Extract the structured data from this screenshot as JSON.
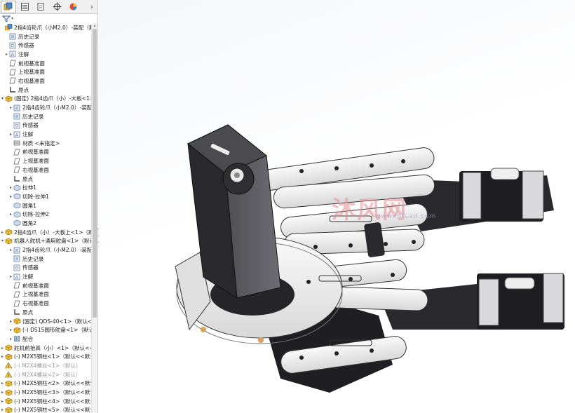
{
  "tabs": [
    "feature-manager",
    "property-manager",
    "configuration-manager",
    "dimxpert-manager",
    "display-manager"
  ],
  "tree": [
    {
      "label": "2指4齿轮爪（小M2.0）-装配（默认<",
      "indent": 0,
      "exp": "",
      "icon": "assembly"
    },
    {
      "label": "历史记录",
      "indent": 1,
      "exp": "",
      "icon": "history"
    },
    {
      "label": "传感器",
      "indent": 1,
      "exp": "",
      "icon": "sensor"
    },
    {
      "label": "注解",
      "indent": 1,
      "exp": "▸",
      "icon": "annotation"
    },
    {
      "label": "前视基准面",
      "indent": 1,
      "exp": "",
      "icon": "plane"
    },
    {
      "label": "上视基准面",
      "indent": 1,
      "exp": "",
      "icon": "plane"
    },
    {
      "label": "右视基准面",
      "indent": 1,
      "exp": "",
      "icon": "plane"
    },
    {
      "label": "原点",
      "indent": 1,
      "exp": "",
      "icon": "origin"
    },
    {
      "label": "(固定) 2指4齿爪（小）-大板<1>",
      "indent": 0,
      "exp": "▾",
      "icon": "part"
    },
    {
      "label": "2指4齿轮爪（小M2.0）-装配",
      "indent": 2,
      "exp": "▸",
      "icon": "history"
    },
    {
      "label": "历史记录",
      "indent": 2,
      "exp": "",
      "icon": "history"
    },
    {
      "label": "传感器",
      "indent": 2,
      "exp": "",
      "icon": "sensor"
    },
    {
      "label": "注解",
      "indent": 2,
      "exp": "▸",
      "icon": "annotation"
    },
    {
      "label": "材质 <未指定>",
      "indent": 2,
      "exp": "",
      "icon": "material"
    },
    {
      "label": "前视基准面",
      "indent": 2,
      "exp": "",
      "icon": "plane"
    },
    {
      "label": "上视基准面",
      "indent": 2,
      "exp": "",
      "icon": "plane"
    },
    {
      "label": "右视基准面",
      "indent": 2,
      "exp": "",
      "icon": "plane"
    },
    {
      "label": "原点",
      "indent": 2,
      "exp": "",
      "icon": "origin"
    },
    {
      "label": "拉伸1",
      "indent": 2,
      "exp": "▸",
      "icon": "feature"
    },
    {
      "label": "切除-拉伸1",
      "indent": 2,
      "exp": "▸",
      "icon": "feature"
    },
    {
      "label": "圆角1",
      "indent": 2,
      "exp": "",
      "icon": "feature"
    },
    {
      "label": "切除-拉伸2",
      "indent": 2,
      "exp": "▸",
      "icon": "feature"
    },
    {
      "label": "圆角2",
      "indent": 2,
      "exp": "",
      "icon": "feature"
    },
    {
      "label": "2指4齿爪（小）-大板上<1>（默",
      "indent": 0,
      "exp": "▸",
      "icon": "part"
    },
    {
      "label": "机器人舵机+通用舵盘<1>（默认",
      "indent": 0,
      "exp": "▾",
      "icon": "part"
    },
    {
      "label": "2指4齿轮爪（小M2.0）-装配",
      "indent": 2,
      "exp": "▸",
      "icon": "history"
    },
    {
      "label": "历史记录",
      "indent": 2,
      "exp": "",
      "icon": "history"
    },
    {
      "label": "传感器",
      "indent": 2,
      "exp": "",
      "icon": "sensor"
    },
    {
      "label": "注解",
      "indent": 2,
      "exp": "▸",
      "icon": "annotation"
    },
    {
      "label": "前视基准面",
      "indent": 2,
      "exp": "",
      "icon": "plane"
    },
    {
      "label": "上视基准面",
      "indent": 2,
      "exp": "",
      "icon": "plane"
    },
    {
      "label": "右视基准面",
      "indent": 2,
      "exp": "",
      "icon": "plane"
    },
    {
      "label": "原点",
      "indent": 2,
      "exp": "",
      "icon": "origin"
    },
    {
      "label": "(固定) QDS-40<1>（默认<",
      "indent": 2,
      "exp": "▸",
      "icon": "part"
    },
    {
      "label": "(-) DS15圆形舵盘<1>（默认",
      "indent": 2,
      "exp": "▸",
      "icon": "part"
    },
    {
      "label": "配合",
      "indent": 2,
      "exp": "▸",
      "icon": "mate"
    },
    {
      "label": "舵机前抬高（小）<1>（默认<<默",
      "indent": 0,
      "exp": "▸",
      "icon": "part"
    },
    {
      "label": "(-) M2X5铜柱<1>（默认<<默认",
      "indent": 0,
      "exp": "▸",
      "icon": "part"
    },
    {
      "label": "(-) M2X4螺丝<1>（默认）",
      "indent": 0,
      "exp": "",
      "icon": "warn",
      "dim": true
    },
    {
      "label": "(-) M2X4螺丝<2>（默认）",
      "indent": 0,
      "exp": "",
      "icon": "warn",
      "dim": true
    },
    {
      "label": "(-) M2X5铜柱<2>（默认<<默认",
      "indent": 0,
      "exp": "▸",
      "icon": "part"
    },
    {
      "label": "(-) M2X5铜柱<3>（默认<<默认",
      "indent": 0,
      "exp": "▸",
      "icon": "part"
    },
    {
      "label": "(-) M2X5铜柱<4>（默认<<默认",
      "indent": 0,
      "exp": "▸",
      "icon": "part"
    },
    {
      "label": "(-) M2X5铜柱<5>（默认<<默认",
      "indent": 0,
      "exp": "▸",
      "icon": "part"
    }
  ],
  "watermark": {
    "main": "沐风网",
    "sub": "www.mfcad.com"
  }
}
